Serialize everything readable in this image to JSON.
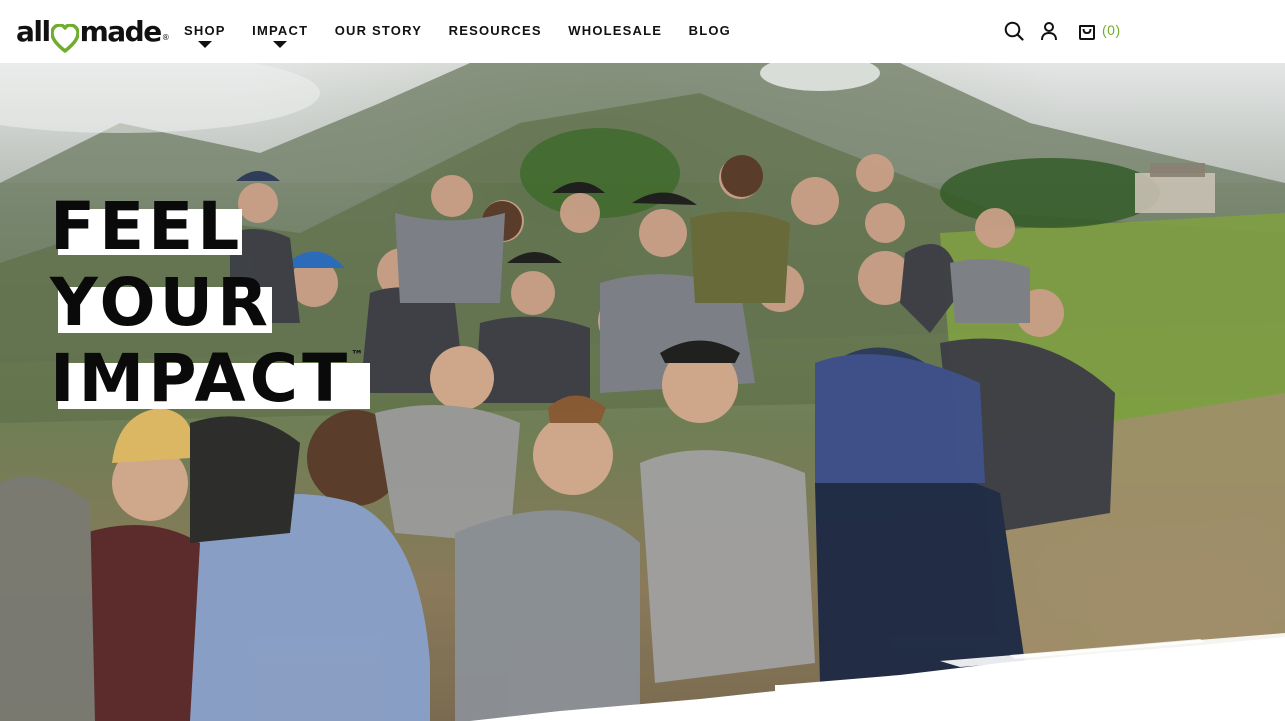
{
  "brand": {
    "logo_left": "all",
    "logo_right": "made",
    "logo_mark": "®"
  },
  "nav": {
    "items": [
      {
        "label": "SHOP",
        "has_dropdown": true
      },
      {
        "label": "IMPACT",
        "has_dropdown": true
      },
      {
        "label": "OUR STORY",
        "has_dropdown": false
      },
      {
        "label": "RESOURCES",
        "has_dropdown": false
      },
      {
        "label": "WHOLESALE",
        "has_dropdown": false
      },
      {
        "label": "BLOG",
        "has_dropdown": false
      }
    ]
  },
  "tools": {
    "search_icon": "search-icon",
    "account_icon": "user-icon",
    "cart_icon": "cart-icon",
    "cart_count": "(0)"
  },
  "hero": {
    "headline": [
      "FEEL",
      "YOUR",
      "IMPACT"
    ],
    "trademark": "™"
  },
  "colors": {
    "accent_green": "#6fae2d",
    "text": "#111111",
    "background": "#ffffff"
  }
}
